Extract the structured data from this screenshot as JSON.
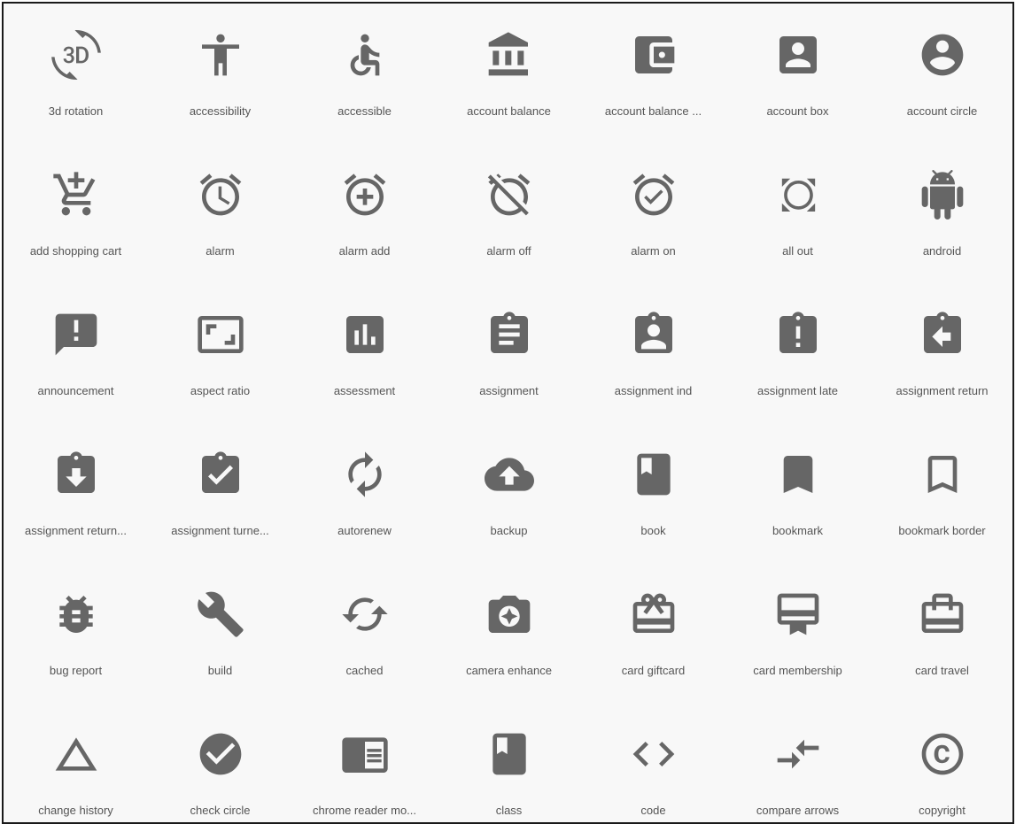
{
  "colors": {
    "icon": "#666666",
    "label": "#555555",
    "background": "#f8f8f8"
  },
  "icons": [
    {
      "label": "3d rotation",
      "icon": "3d-rotation-icon"
    },
    {
      "label": "accessibility",
      "icon": "accessibility-icon"
    },
    {
      "label": "accessible",
      "icon": "accessible-icon"
    },
    {
      "label": "account balance",
      "icon": "account-balance-icon"
    },
    {
      "label": "account balance ...",
      "icon": "account-balance-wallet-icon"
    },
    {
      "label": "account box",
      "icon": "account-box-icon"
    },
    {
      "label": "account circle",
      "icon": "account-circle-icon"
    },
    {
      "label": "add shopping cart",
      "icon": "add-shopping-cart-icon"
    },
    {
      "label": "alarm",
      "icon": "alarm-icon"
    },
    {
      "label": "alarm add",
      "icon": "alarm-add-icon"
    },
    {
      "label": "alarm off",
      "icon": "alarm-off-icon"
    },
    {
      "label": "alarm on",
      "icon": "alarm-on-icon"
    },
    {
      "label": "all out",
      "icon": "all-out-icon"
    },
    {
      "label": "android",
      "icon": "android-icon"
    },
    {
      "label": "announcement",
      "icon": "announcement-icon"
    },
    {
      "label": "aspect ratio",
      "icon": "aspect-ratio-icon"
    },
    {
      "label": "assessment",
      "icon": "assessment-icon"
    },
    {
      "label": "assignment",
      "icon": "assignment-icon"
    },
    {
      "label": "assignment ind",
      "icon": "assignment-ind-icon"
    },
    {
      "label": "assignment late",
      "icon": "assignment-late-icon"
    },
    {
      "label": "assignment return",
      "icon": "assignment-return-icon"
    },
    {
      "label": "assignment return...",
      "icon": "assignment-returned-icon"
    },
    {
      "label": "assignment turne...",
      "icon": "assignment-turned-in-icon"
    },
    {
      "label": "autorenew",
      "icon": "autorenew-icon"
    },
    {
      "label": "backup",
      "icon": "backup-icon"
    },
    {
      "label": "book",
      "icon": "book-icon"
    },
    {
      "label": "bookmark",
      "icon": "bookmark-icon"
    },
    {
      "label": "bookmark border",
      "icon": "bookmark-border-icon"
    },
    {
      "label": "bug report",
      "icon": "bug-report-icon"
    },
    {
      "label": "build",
      "icon": "build-icon"
    },
    {
      "label": "cached",
      "icon": "cached-icon"
    },
    {
      "label": "camera enhance",
      "icon": "camera-enhance-icon"
    },
    {
      "label": "card giftcard",
      "icon": "card-giftcard-icon"
    },
    {
      "label": "card membership",
      "icon": "card-membership-icon"
    },
    {
      "label": "card travel",
      "icon": "card-travel-icon"
    },
    {
      "label": "change history",
      "icon": "change-history-icon"
    },
    {
      "label": "check circle",
      "icon": "check-circle-icon"
    },
    {
      "label": "chrome reader mo...",
      "icon": "chrome-reader-mode-icon"
    },
    {
      "label": "class",
      "icon": "class-icon"
    },
    {
      "label": "code",
      "icon": "code-icon"
    },
    {
      "label": "compare arrows",
      "icon": "compare-arrows-icon"
    },
    {
      "label": "copyright",
      "icon": "copyright-icon"
    }
  ]
}
